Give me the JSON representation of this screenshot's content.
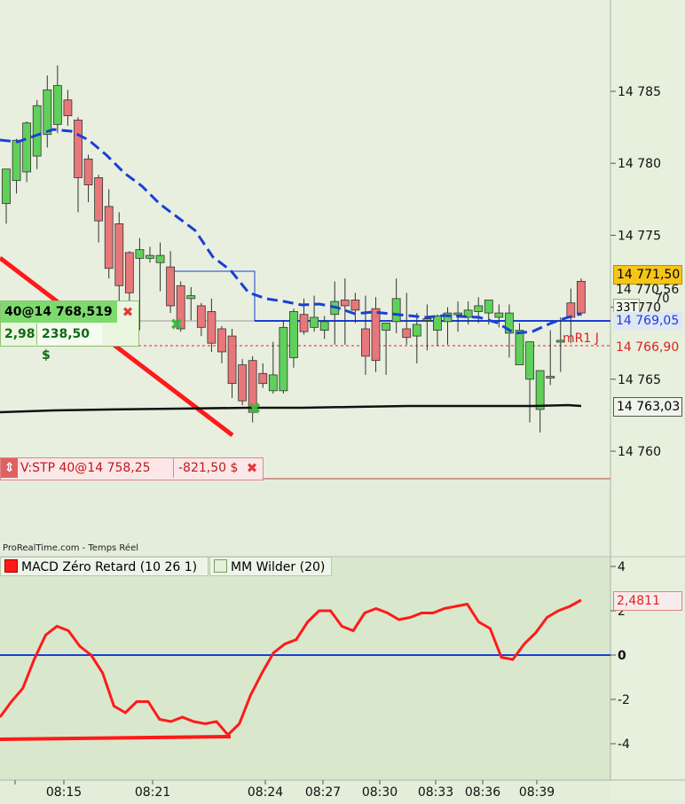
{
  "source_label": "ProRealTime.com - Temps Réel",
  "price_labels": {
    "last": "14 771,50",
    "ask": "14 770,56",
    "countdown": "33T",
    "blue_line": "14 769,05",
    "mr1": "14 766,90",
    "mr1_name": "mR1 J",
    "black_ma": "14 763,03",
    "partial_70": "70"
  },
  "order": {
    "label": "40@14 768,519",
    "points": "2,98",
    "pnl": "238,50 $",
    "close": "✖"
  },
  "stop": {
    "arrow": "⇕",
    "label": "V:STP 40@14 758,25",
    "pnl": "-821,50 $",
    "close": "✖"
  },
  "legend": {
    "macd": "MACD Zéro Retard (10 26 1)",
    "wilder": "MM Wilder (20)"
  },
  "colors": {
    "bull": "#5fd15a",
    "bear": "#e8777a",
    "ma_blue": "#1a3fd6",
    "red_line": "#ff1a1a",
    "last_tag": "#f5c518"
  },
  "chart_data": [
    {
      "type": "candlestick",
      "ylim": [
        14755.3,
        14788.6
      ],
      "y_ticks": [
        14760,
        14765,
        14770,
        14775,
        14780,
        14785
      ],
      "y_tick_labels": [
        "14 760",
        "14 765",
        "14 770",
        "14 775",
        "14 780",
        "14 785"
      ],
      "x_tick_labels": [
        "08:15",
        "08:21",
        "08:24",
        "08:27",
        "08:30",
        "08:33",
        "08:36",
        "08:39"
      ],
      "x_tick_index": [
        5,
        12,
        23,
        28,
        33,
        38,
        42,
        47
      ],
      "candles": [
        {
          "o": 14777.2,
          "h": 14779.6,
          "l": 14775.8,
          "c": 14779.6
        },
        {
          "o": 14778.8,
          "h": 14781.7,
          "l": 14777.9,
          "c": 14781.6
        },
        {
          "o": 14779.4,
          "h": 14782.9,
          "l": 14778.7,
          "c": 14782.8
        },
        {
          "o": 14780.5,
          "h": 14784.4,
          "l": 14779.6,
          "c": 14784.0
        },
        {
          "o": 14782.0,
          "h": 14786.1,
          "l": 14781.1,
          "c": 14785.1
        },
        {
          "o": 14782.7,
          "h": 14786.8,
          "l": 14782.1,
          "c": 14785.4
        },
        {
          "o": 14784.4,
          "h": 14785.1,
          "l": 14782.6,
          "c": 14783.3
        },
        {
          "o": 14783.0,
          "h": 14783.2,
          "l": 14776.6,
          "c": 14779.0
        },
        {
          "o": 14780.3,
          "h": 14780.6,
          "l": 14777.3,
          "c": 14778.5
        },
        {
          "o": 14779.0,
          "h": 14779.2,
          "l": 14774.5,
          "c": 14776.0
        },
        {
          "o": 14777.0,
          "h": 14778.2,
          "l": 14772.0,
          "c": 14772.7
        },
        {
          "o": 14775.8,
          "h": 14776.6,
          "l": 14770.0,
          "c": 14771.5
        },
        {
          "o": 14773.8,
          "h": 14773.9,
          "l": 14769.0,
          "c": 14771.0
        },
        {
          "o": 14773.4,
          "h": 14774.8,
          "l": 14768.4,
          "c": 14774.0
        },
        {
          "o": 14773.4,
          "h": 14774.2,
          "l": 14773.1,
          "c": 14773.6
        },
        {
          "o": 14773.1,
          "h": 14774.5,
          "l": 14771.1,
          "c": 14773.6
        },
        {
          "o": 14772.8,
          "h": 14773.9,
          "l": 14769.6,
          "c": 14770.1
        },
        {
          "o": 14771.5,
          "h": 14771.8,
          "l": 14768.3,
          "c": 14768.5
        },
        {
          "o": 14770.6,
          "h": 14771.4,
          "l": 14769.1,
          "c": 14770.8
        },
        {
          "o": 14770.1,
          "h": 14770.3,
          "l": 14768.0,
          "c": 14768.6
        },
        {
          "o": 14769.7,
          "h": 14770.6,
          "l": 14766.9,
          "c": 14767.5
        },
        {
          "o": 14768.5,
          "h": 14768.7,
          "l": 14766.1,
          "c": 14766.9
        },
        {
          "o": 14768.0,
          "h": 14768.5,
          "l": 14763.7,
          "c": 14764.7
        },
        {
          "o": 14766.0,
          "h": 14766.4,
          "l": 14763.2,
          "c": 14763.5
        },
        {
          "o": 14766.3,
          "h": 14766.6,
          "l": 14762.0,
          "c": 14762.7
        },
        {
          "o": 14765.4,
          "h": 14766.1,
          "l": 14764.4,
          "c": 14764.7
        },
        {
          "o": 14764.2,
          "h": 14767.6,
          "l": 14764.0,
          "c": 14765.3
        },
        {
          "o": 14764.2,
          "h": 14769.1,
          "l": 14764.0,
          "c": 14768.6
        },
        {
          "o": 14766.5,
          "h": 14769.9,
          "l": 14765.8,
          "c": 14769.7
        }
      ]
    },
    {
      "type": "line",
      "title": "MACD Zéro Retard (10 26 1)",
      "ylim": [
        -5.5,
        4.3
      ],
      "y_ticks": [
        4,
        2,
        0,
        -2,
        -4
      ],
      "y_tick_labels": [
        "4",
        "2",
        "0",
        "-2",
        "-4"
      ],
      "last_value": "2,4811",
      "series": [
        {
          "name": "MACD Zéro Retard (10 26 1)",
          "values": [
            -2.8,
            -2.1,
            -1.5,
            -0.2,
            0.9,
            1.3,
            1.1,
            0.4,
            0.0,
            -0.8,
            -2.3,
            -2.6,
            -2.1,
            -2.1,
            -2.9,
            -3.0,
            -2.8,
            -3.0,
            -3.1,
            -3.0,
            -3.6,
            -3.1,
            -1.8,
            -0.8,
            0.1,
            0.5,
            0.7,
            1.5,
            2.0,
            2.0,
            1.3,
            1.1,
            1.9,
            2.1,
            1.9,
            1.6,
            1.7,
            1.9,
            1.9,
            2.1,
            2.2,
            2.3,
            1.5,
            1.2,
            -0.1,
            -0.2,
            0.5,
            1.0,
            1.7,
            2.0,
            2.2,
            2.48
          ]
        },
        {
          "name": "MM Wilder (20)",
          "values": [
            0,
            0,
            0,
            0,
            0,
            0,
            0,
            0,
            0,
            0,
            0,
            0,
            0,
            0,
            0,
            0,
            0,
            0,
            0,
            0,
            0,
            0,
            0,
            0,
            0,
            0,
            0,
            0,
            0,
            0,
            0,
            0,
            0,
            0,
            0,
            0,
            0,
            0,
            0,
            0,
            0,
            0,
            0,
            0,
            0,
            0,
            0,
            0,
            0,
            0,
            0,
            0
          ]
        }
      ]
    }
  ]
}
